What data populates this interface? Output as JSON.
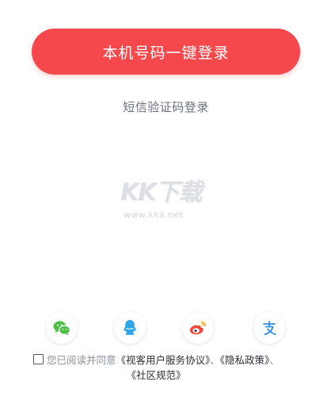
{
  "login": {
    "one_click_label": "本机号码一键登录",
    "sms_label": "短信验证码登录"
  },
  "watermark": {
    "logo_text": "KK下载",
    "url_text": "www.kkx.net"
  },
  "social": [
    {
      "name": "wechat",
      "icon": "wechat-icon",
      "color": "#4fbf4a"
    },
    {
      "name": "qq",
      "icon": "qq-icon",
      "color": "#2fa4e7"
    },
    {
      "name": "weibo",
      "icon": "weibo-icon",
      "color": "#f0483f"
    },
    {
      "name": "alipay",
      "icon": "alipay-icon",
      "color": "#2f8ce8"
    }
  ],
  "agreement": {
    "prefix": "您已阅读并同意",
    "user_agreement": "《视客用户服务协议》",
    "sep1": "、",
    "privacy_policy": "《隐私政策》",
    "sep2": "、",
    "community_rules": "《社区规范》",
    "checked": false
  },
  "colors": {
    "primary": "#f5484c",
    "secondary_text": "#6b7180",
    "agreement_text": "#8a8f99",
    "link_text": "#2b2f36"
  }
}
